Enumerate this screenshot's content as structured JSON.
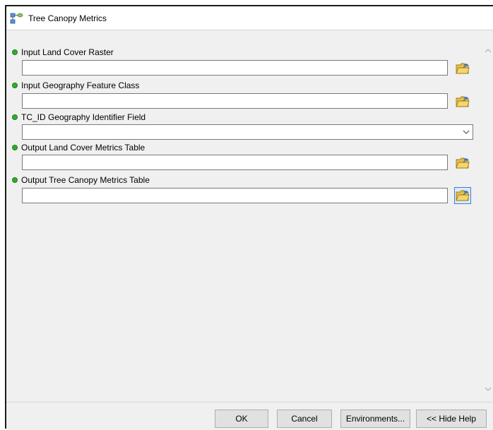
{
  "window": {
    "title": "Tree Canopy Metrics",
    "icon": "model-tool-icon"
  },
  "parameters": [
    {
      "label": "Input Land Cover Raster",
      "value": "",
      "control": "file-browse",
      "required": true
    },
    {
      "label": "Input Geography Feature Class",
      "value": "",
      "control": "file-browse",
      "required": true
    },
    {
      "label": "TC_ID Geography Identifier Field",
      "value": "",
      "control": "dropdown",
      "required": true
    },
    {
      "label": "Output Land Cover Metrics Table",
      "value": "",
      "control": "file-browse",
      "required": true
    },
    {
      "label": "Output Tree Canopy Metrics Table",
      "value": "",
      "control": "file-browse",
      "required": true
    }
  ],
  "buttons": {
    "ok": "OK",
    "cancel": "Cancel",
    "environments": "Environments...",
    "hide_help": "<< Hide Help"
  },
  "colors": {
    "required_bullet": "#2fae2f",
    "dialog_bg": "#f0f0f0",
    "focus_border": "#3c7fd0"
  }
}
